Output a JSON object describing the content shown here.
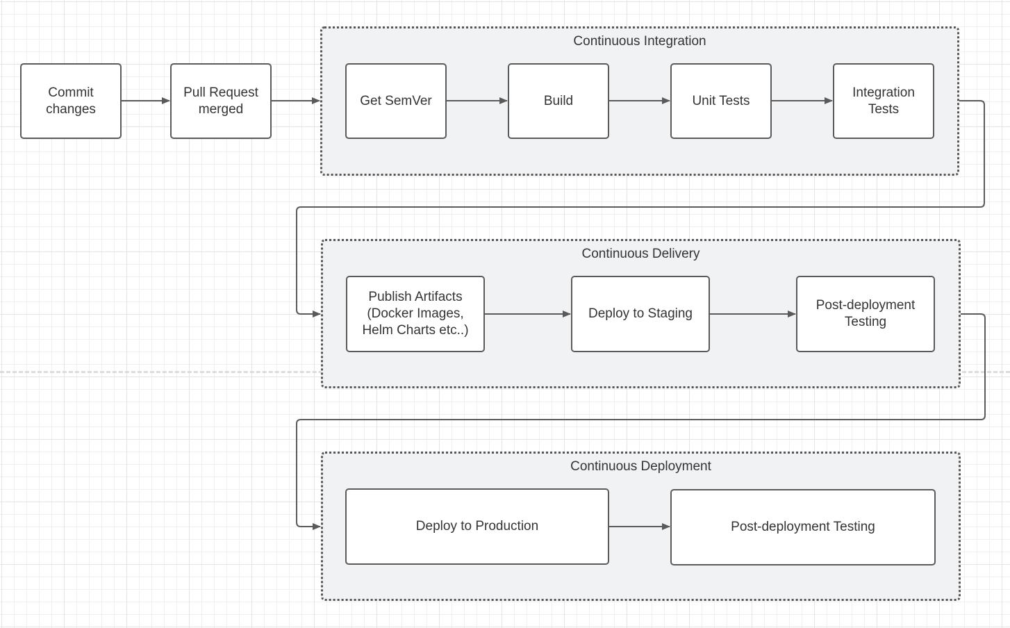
{
  "nodes": {
    "commit": "Commit\nchanges",
    "pull_request": "Pull Request\nmerged"
  },
  "ci": {
    "title": "Continuous Integration",
    "steps": [
      "Get SemVer",
      "Build",
      "Unit Tests",
      "Integration\nTests"
    ]
  },
  "cd": {
    "title": "Continuous Delivery",
    "steps": [
      "Publish Artifacts\n(Docker Images,\nHelm Charts etc..)",
      "Deploy to Staging",
      "Post-deployment\nTesting"
    ]
  },
  "cdep": {
    "title": "Continuous Deployment",
    "steps": [
      "Deploy to Production",
      "Post-deployment Testing"
    ]
  },
  "colors": {
    "stroke": "#5a5a5a",
    "container_fill": "#f1f2f4",
    "text": "#333333"
  }
}
